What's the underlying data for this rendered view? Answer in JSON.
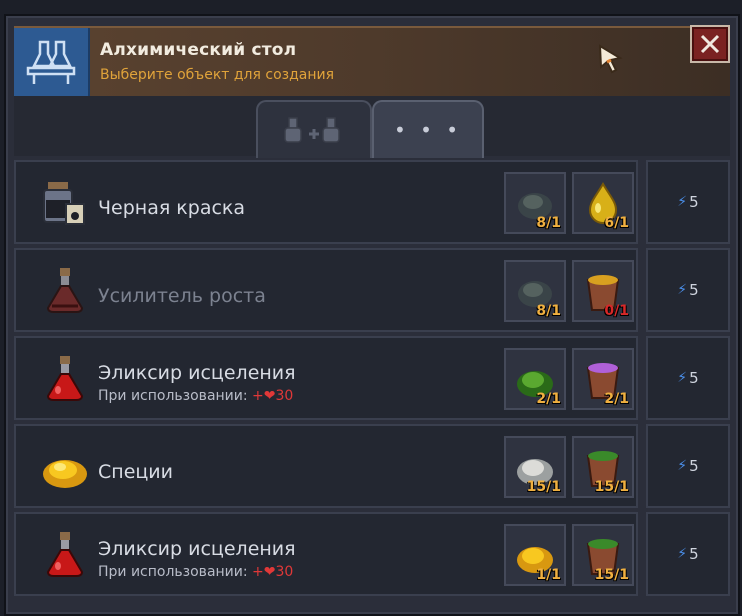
{
  "header": {
    "title": "Алхимический стол",
    "subtitle": "Выберите объект для создания"
  },
  "tabs": [
    {
      "label": ""
    },
    {
      "label": "• • •"
    }
  ],
  "recipes": [
    {
      "name": "Черная краска",
      "dim": false,
      "sub": "",
      "energy": "5",
      "ingredients": [
        {
          "icon": "dark-dust-icon",
          "count": "8/1",
          "ok": true
        },
        {
          "icon": "golden-drop-icon",
          "count": "6/1",
          "ok": true
        }
      ]
    },
    {
      "name": "Усилитель роста",
      "dim": true,
      "sub": "",
      "energy": "5",
      "ingredients": [
        {
          "icon": "dark-dust-icon",
          "count": "8/1",
          "ok": true
        },
        {
          "icon": "yellow-bucket-icon",
          "count": "0/1",
          "ok": false
        }
      ]
    },
    {
      "name": "Эликсир исцеления",
      "dim": false,
      "sub": "При использовании:",
      "bonus": "+❤30",
      "energy": "5",
      "ingredients": [
        {
          "icon": "green-herb-icon",
          "count": "2/1",
          "ok": true
        },
        {
          "icon": "purple-bucket-icon",
          "count": "2/1",
          "ok": true
        }
      ]
    },
    {
      "name": "Специи",
      "dim": false,
      "sub": "",
      "energy": "5",
      "ingredients": [
        {
          "icon": "white-salt-icon",
          "count": "15/1",
          "ok": true
        },
        {
          "icon": "green-bucket-icon",
          "count": "15/1",
          "ok": true
        }
      ]
    },
    {
      "name": "Эликсир исцеления",
      "dim": false,
      "sub": "При использовании:",
      "bonus": "+❤30",
      "energy": "5",
      "ingredients": [
        {
          "icon": "spice-pile-icon",
          "count": "1/1",
          "ok": true
        },
        {
          "icon": "green-bucket-icon",
          "count": "15/1",
          "ok": true
        }
      ]
    }
  ],
  "colors": {
    "accent": "#e0a33a",
    "bad": "#d82828",
    "ok": "#f0b040",
    "energy": "#4a8ee8"
  }
}
